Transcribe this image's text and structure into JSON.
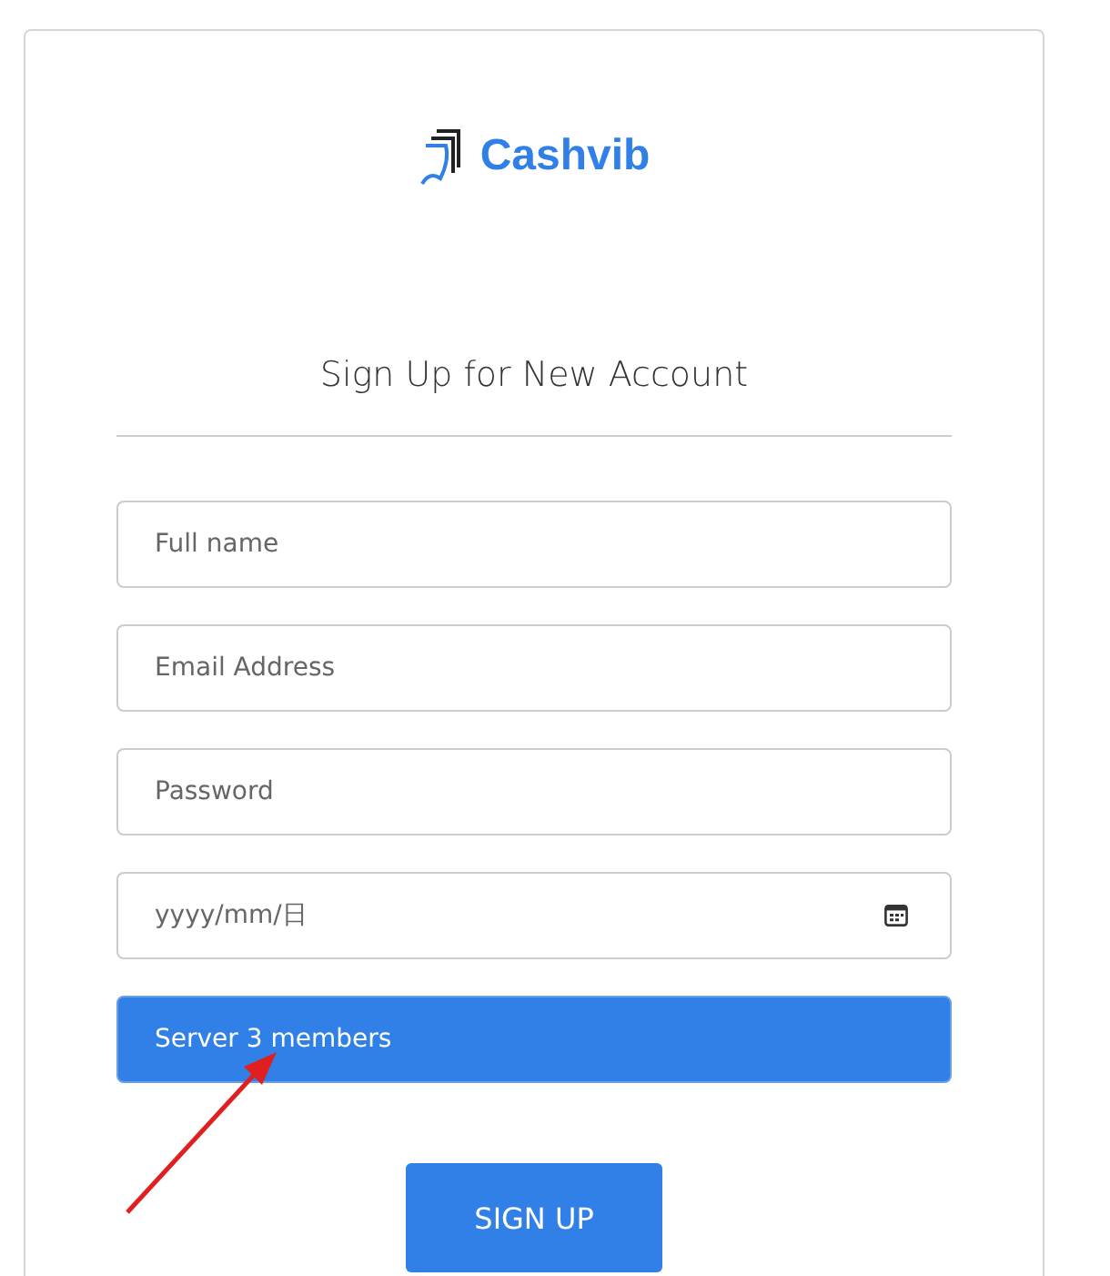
{
  "logo": {
    "text": "Cashvib"
  },
  "title": "Sign Up for New Account",
  "fields": [
    {
      "kind": "text",
      "placeholder": "Full name"
    },
    {
      "kind": "text",
      "placeholder": "Email Address"
    },
    {
      "kind": "password",
      "placeholder": "Password"
    },
    {
      "kind": "date",
      "placeholder": "yyyy/mm/日"
    }
  ],
  "server_select": {
    "value": "Server 3 members"
  },
  "submit_button": "SIGN UP",
  "annotation": {
    "kind": "arrow"
  }
}
